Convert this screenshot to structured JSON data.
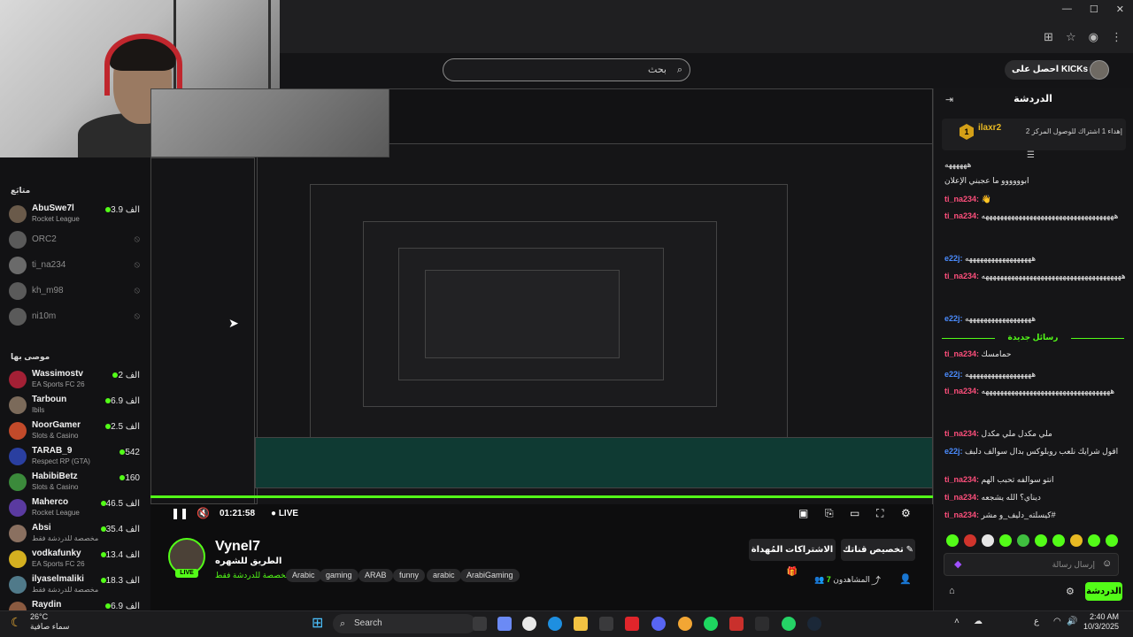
{
  "browser": {
    "window_controls": [
      "—",
      "☐",
      "✕"
    ]
  },
  "topbar": {
    "search_placeholder": "بحث",
    "get_kicks": "احصل على KICKs"
  },
  "sidebar": {
    "following_title": "متابَع",
    "following": [
      {
        "name": "AbuSwe7l",
        "game": "Rocket League",
        "viewers": "3.9 الف",
        "live": true,
        "color": "#6a5a4a"
      },
      {
        "name": "ORC2",
        "game": "",
        "viewers": "",
        "live": false,
        "color": "#5a5a5a"
      },
      {
        "name": "ti_na234",
        "game": "",
        "viewers": "",
        "live": false,
        "color": "#6a6a6a"
      },
      {
        "name": "kh_m98",
        "game": "",
        "viewers": "",
        "live": false,
        "color": "#5a5a5a"
      },
      {
        "name": "ni10m",
        "game": "",
        "viewers": "",
        "live": false,
        "color": "#5a5a5a"
      }
    ],
    "recommended_title": "موصى بها",
    "recommended": [
      {
        "name": "Wassimostv",
        "game": "EA Sports FC 26",
        "viewers": "2 الف",
        "color": "#a32035"
      },
      {
        "name": "Tarboun",
        "game": "Ibils",
        "viewers": "6.9 الف",
        "color": "#7b6a5a"
      },
      {
        "name": "NoorGamer",
        "game": "Slots & Casino",
        "viewers": "2.5 الف",
        "color": "#c24a2a"
      },
      {
        "name": "TARAB_9",
        "game": "Respect RP (GTA)",
        "viewers": "542",
        "color": "#2a3fa0"
      },
      {
        "name": "HabibiBetz",
        "game": "Slots & Casino",
        "viewers": "160",
        "color": "#3b8a3b"
      },
      {
        "name": "Maherco",
        "game": "Rocket League",
        "viewers": "46.5 الف",
        "color": "#5a3aa0"
      },
      {
        "name": "Absi",
        "game": "مخصصة للدردشة فقط",
        "viewers": "35.4 الف",
        "color": "#8a7060"
      },
      {
        "name": "vodkafunky",
        "game": "EA Sports FC 26",
        "viewers": "13.4 الف",
        "color": "#d4b020"
      },
      {
        "name": "ilyaselmaliki",
        "game": "مخصصة للدردشة فقط",
        "viewers": "18.3 الف",
        "color": "#507a8a"
      },
      {
        "name": "Raydin",
        "game": "",
        "viewers": "6.9 الف",
        "color": "#8a5a40"
      }
    ]
  },
  "player": {
    "time": "01:21:58",
    "live": "LIVE"
  },
  "streamer": {
    "name": "Vynel7",
    "title": "الطريق للشهره",
    "category": "مخصصة للدردشة فقط",
    "live_badge": "LIVE",
    "tags": [
      "Arabic",
      "gaming",
      "ARAB",
      "funny",
      "arabic",
      "ArabiGaming"
    ],
    "subscribe_label": "الاشتراكات المُهداة",
    "customize_label": "تخصيص قناتك",
    "viewers_label": "المشاهدون",
    "viewers_count": "7"
  },
  "chat": {
    "title": "الدردشة",
    "pinned_user": "ilaxr2",
    "pinned_rank": "1",
    "pinned_text": "إهداء 1 اشتراك للوصول المركز 2",
    "new_messages_label": "رسائل جديدة",
    "input_placeholder": "إرسال رسالة",
    "send_label": "الدردشة",
    "messages": [
      {
        "user": "",
        "text": "ههههههه",
        "color": "pink"
      },
      {
        "user": "",
        "text": "ابوووووو ما عجبني الإعلان",
        "color": "pink"
      },
      {
        "user": "ti_na234:",
        "text": "👋",
        "color": "pink"
      },
      {
        "user": "ti_na234:",
        "text": "ههههههههههههههههههههههههههههههههههههه",
        "color": "pink"
      },
      {
        "user": "e22j:",
        "text": "ههههههههههههههههههه",
        "color": "blue"
      },
      {
        "user": "ti_na234:",
        "text": "ههههههههههههههههههههههههههههههههههههههه",
        "color": "pink"
      },
      {
        "user": "e22j:",
        "text": "ههههههههههههههههههه",
        "color": "blue"
      },
      {
        "user": "ti_na234:",
        "text": "حمامسك",
        "color": "pink"
      },
      {
        "user": "e22j:",
        "text": "ههههههههههههههههههه",
        "color": "blue"
      },
      {
        "user": "ti_na234:",
        "text": "هههههههههههههههههههههههههههههههههههه",
        "color": "pink"
      },
      {
        "user": "ti_na234:",
        "text": "ملي مكدل ملي مكدل",
        "color": "pink"
      },
      {
        "user": "e22j:",
        "text": "اقول شرايك نلعب روبلوكس بدال سوالف دلبف",
        "color": "blue"
      },
      {
        "user": "ti_na234:",
        "text": "انتو سوالفه تحبب الهم",
        "color": "pink"
      },
      {
        "user": "ti_na234:",
        "text": "ديناي؟ الله يشجعه",
        "color": "pink"
      },
      {
        "user": "ti_na234:",
        "text": "كيسلته_دليف_و مشر#",
        "color": "pink"
      }
    ]
  },
  "taskbar": {
    "temperature": "26°C",
    "weather": "سماء صافية",
    "search": "Search",
    "time": "2:40 AM",
    "date": "10/3/2025",
    "lang": "ع"
  },
  "colors": {
    "accent": "#53fc18",
    "chat_user_pink": "#ff4f7c",
    "chat_user_blue": "#4b8cff"
  }
}
